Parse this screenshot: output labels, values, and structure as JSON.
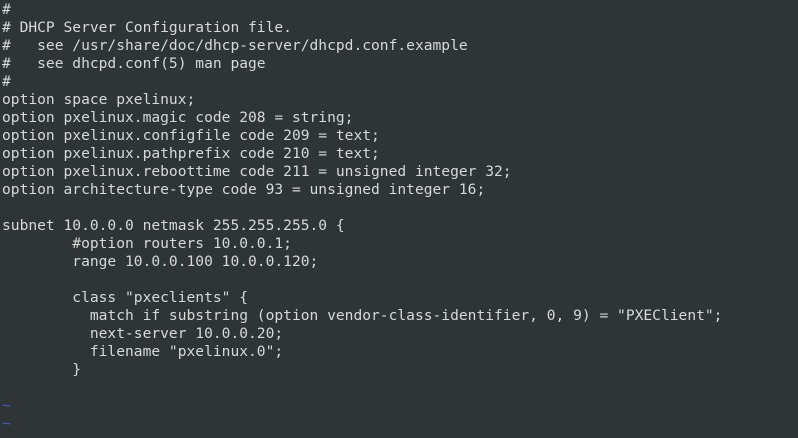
{
  "editor": {
    "lines": [
      "#",
      "# DHCP Server Configuration file.",
      "#   see /usr/share/doc/dhcp-server/dhcpd.conf.example",
      "#   see dhcpd.conf(5) man page",
      "#",
      "option space pxelinux;",
      "option pxelinux.magic code 208 = string;",
      "option pxelinux.configfile code 209 = text;",
      "option pxelinux.pathprefix code 210 = text;",
      "option pxelinux.reboottime code 211 = unsigned integer 32;",
      "option architecture-type code 93 = unsigned integer 16;",
      "",
      "subnet 10.0.0.0 netmask 255.255.255.0 {",
      "        #option routers 10.0.0.1;",
      "        range 10.0.0.100 10.0.0.120;",
      "",
      "        class \"pxeclients\" {",
      "          match if substring (option vendor-class-identifier, 0, 9) = \"PXEClient\";",
      "          next-server 10.0.0.20;",
      "          filename \"pxelinux.0\";",
      "        }",
      "",
      "~",
      "~"
    ]
  }
}
